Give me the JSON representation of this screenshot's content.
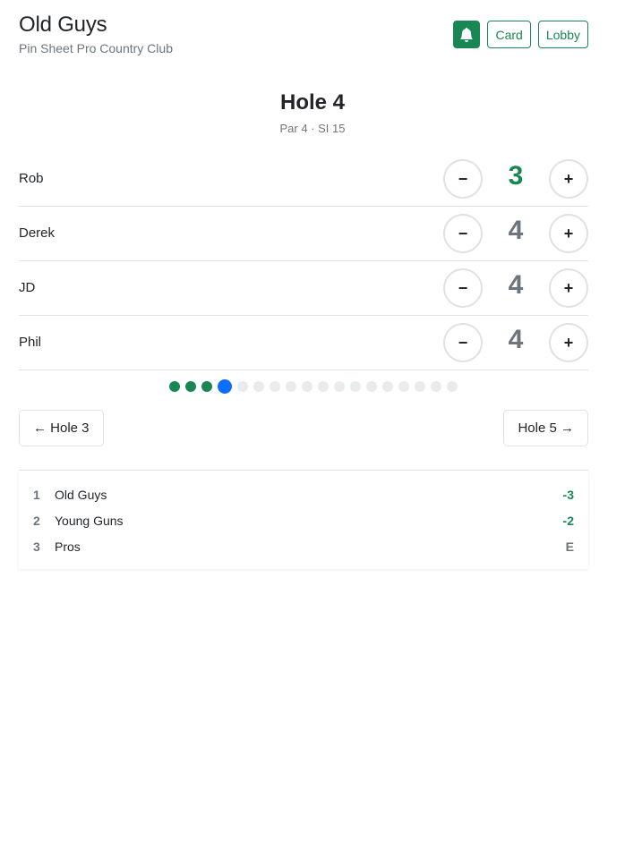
{
  "header": {
    "team_name": "Old Guys",
    "course_name": "Pin Sheet Pro Country Club",
    "actions": {
      "card_label": "Card",
      "lobby_label": "Lobby",
      "bell_icon": "bell-icon"
    }
  },
  "hole": {
    "title": "Hole 4",
    "subtitle": "Par 4 · SI 15"
  },
  "players": [
    {
      "name": "Rob",
      "score": "3",
      "status": "under"
    },
    {
      "name": "Derek",
      "score": "4",
      "status": "par"
    },
    {
      "name": "JD",
      "score": "4",
      "status": "par"
    },
    {
      "name": "Phil",
      "score": "4",
      "status": "par"
    }
  ],
  "stepper": {
    "minus_label": "−",
    "plus_label": "+"
  },
  "progress": {
    "total_holes": 18,
    "completed": 3,
    "current": 4
  },
  "navigation": {
    "prev_label": "← Hole 3",
    "next_label": "Hole 5 →"
  },
  "leaderboard": [
    {
      "rank": "1",
      "team": "Old Guys",
      "score": "-3",
      "status": "under"
    },
    {
      "rank": "2",
      "team": "Young Guns",
      "score": "-2",
      "status": "under"
    },
    {
      "rank": "3",
      "team": "Pros",
      "score": "E",
      "status": "even"
    }
  ],
  "colors": {
    "accent": "#198754",
    "current_hole": "#0d6efd",
    "muted": "#6c757d"
  }
}
